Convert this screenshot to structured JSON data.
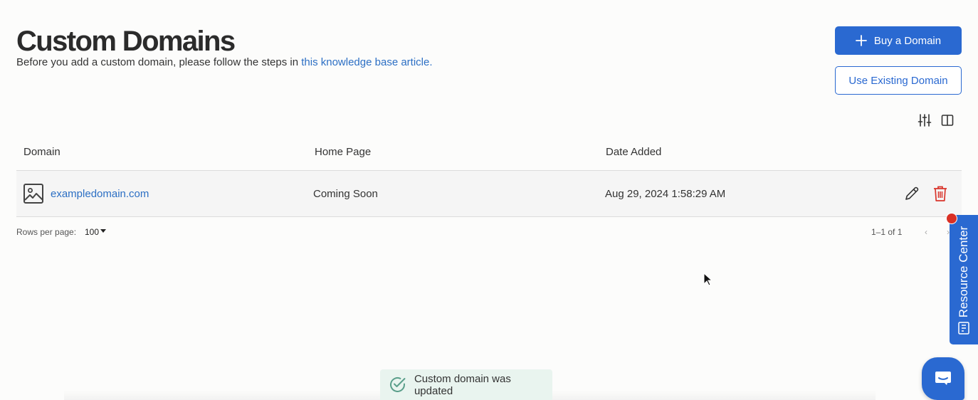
{
  "header": {
    "title": "Custom Domains",
    "intro_text": "Before you add a custom domain, please follow the steps in ",
    "intro_link": "this knowledge base article."
  },
  "actions": {
    "buy_label": "Buy a Domain",
    "use_existing_label": "Use Existing Domain"
  },
  "table": {
    "columns": [
      "Domain",
      "Home Page",
      "Date Added"
    ],
    "rows": [
      {
        "domain": "exampledomain.com",
        "home_page": "Coming Soon",
        "date_added": "Aug 29, 2024 1:58:29 AM"
      }
    ]
  },
  "pagination": {
    "rows_per_page_label": "Rows per page:",
    "rows_per_page_value": "100",
    "range": "1–1 of 1",
    "prev": "‹",
    "next": "›"
  },
  "resource_center": {
    "label": "Resource Center"
  },
  "toast": {
    "message": "Custom domain was updated"
  },
  "colors": {
    "accent": "#2a69d1",
    "link": "#2c6fc4",
    "danger": "#d9342b",
    "toast_bg": "#e9f4ef",
    "toast_check": "#5a9e8a"
  }
}
